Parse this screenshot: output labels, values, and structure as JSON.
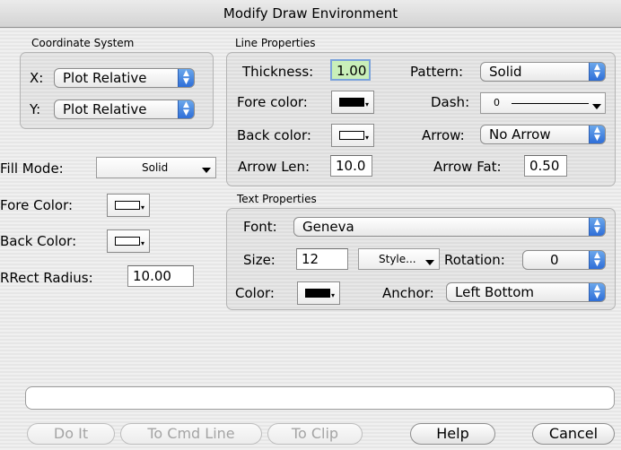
{
  "window": {
    "title": "Modify Draw Environment"
  },
  "coordinate_system": {
    "label": "Coordinate System",
    "x_label": "X:",
    "x_value": "Plot Relative",
    "y_label": "Y:",
    "y_value": "Plot Relative"
  },
  "fill": {
    "mode_label": "Fill Mode:",
    "mode_value": "Solid",
    "fore_label": "Fore Color:",
    "fore_color": "#ffffff",
    "back_label": "Back Color:",
    "back_color": "#ffffff",
    "rrect_label": "RRect Radius:",
    "rrect_value": "10.00"
  },
  "line": {
    "label": "Line Properties",
    "thickness_label": "Thickness:",
    "thickness_value": "1.00",
    "pattern_label": "Pattern:",
    "pattern_value": "Solid",
    "fore_label": "Fore color:",
    "fore_color": "#000000",
    "dash_label": "Dash:",
    "dash_value": "0",
    "back_label": "Back color:",
    "back_color": "#ffffff",
    "arrow_label": "Arrow:",
    "arrow_value": "No Arrow",
    "arrowlen_label": "Arrow Len:",
    "arrowlen_value": "10.0",
    "arrowfat_label": "Arrow Fat:",
    "arrowfat_value": "0.50"
  },
  "text": {
    "label": "Text Properties",
    "font_label": "Font:",
    "font_value": "Geneva",
    "size_label": "Size:",
    "size_value": "12",
    "style_button": "Style...",
    "rotation_label": "Rotation:",
    "rotation_value": "0",
    "color_label": "Color:",
    "color": "#000000",
    "anchor_label": "Anchor:",
    "anchor_value": "Left Bottom"
  },
  "command_field": {
    "value": ""
  },
  "buttons": {
    "doit": "Do It",
    "tocmd": "To Cmd Line",
    "toclip": "To Clip",
    "help": "Help",
    "cancel": "Cancel"
  },
  "colors": {
    "accent_blue": "#3a7ce0",
    "highlight_field": "#c9efb9"
  }
}
